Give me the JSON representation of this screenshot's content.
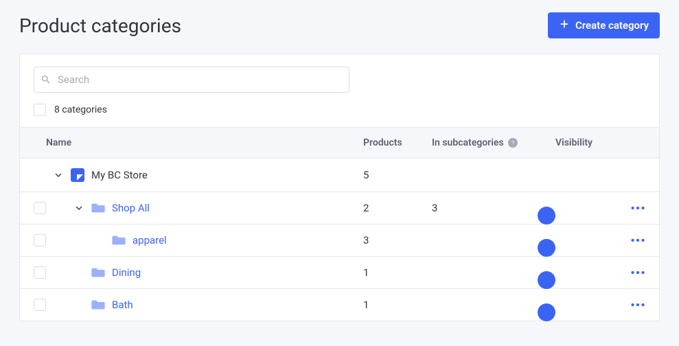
{
  "header": {
    "title": "Product categories",
    "create_label": "Create category"
  },
  "search": {
    "placeholder": "Search"
  },
  "count": {
    "label": "8 categories"
  },
  "columns": {
    "name": "Name",
    "products": "Products",
    "subcategories": "In subcategories",
    "visibility": "Visibility"
  },
  "rows": {
    "root": {
      "name": "My BC Store",
      "products": "5",
      "sub": ""
    },
    "shop_all": {
      "name": "Shop All",
      "products": "2",
      "sub": "3"
    },
    "apparel": {
      "name": "apparel",
      "products": "3",
      "sub": ""
    },
    "dining": {
      "name": "Dining",
      "products": "1",
      "sub": ""
    },
    "bath": {
      "name": "Bath",
      "products": "1",
      "sub": ""
    }
  }
}
